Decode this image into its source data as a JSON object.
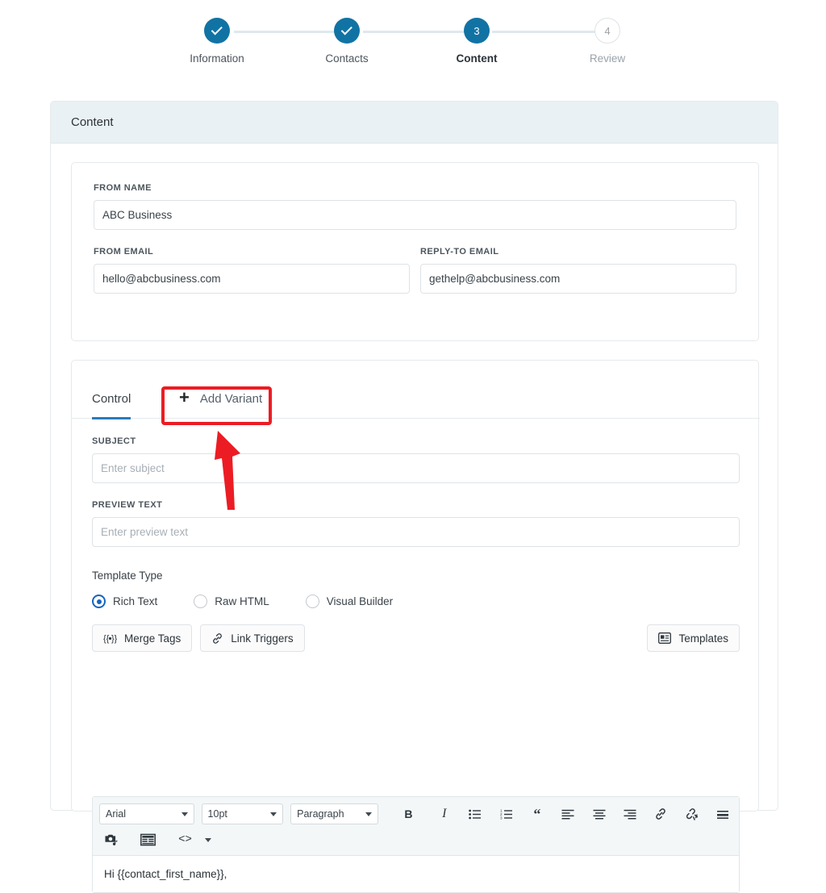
{
  "stepper": {
    "steps": [
      {
        "num": "1",
        "label": "Information",
        "state": "done",
        "icon": "check-icon"
      },
      {
        "num": "2",
        "label": "Contacts",
        "state": "done",
        "icon": "check-icon"
      },
      {
        "num": "3",
        "label": "Content",
        "state": "current",
        "icon": ""
      },
      {
        "num": "4",
        "label": "Review",
        "state": "todo",
        "icon": ""
      }
    ]
  },
  "panel": {
    "title": "Content"
  },
  "sender": {
    "from_name": {
      "label": "FROM NAME",
      "value": "ABC Business",
      "placeholder": ""
    },
    "from_email": {
      "label": "FROM EMAIL",
      "value": "hello@abcbusiness.com",
      "placeholder": ""
    },
    "reply_to_email": {
      "label": "REPLY-TO EMAIL",
      "value": "gethelp@abcbusiness.com",
      "placeholder": ""
    }
  },
  "variant": {
    "tabs": [
      {
        "id": "control",
        "label": "Control",
        "active": true
      },
      {
        "id": "add-variant",
        "label": "Add Variant",
        "icon": "plus-icon",
        "active": false
      }
    ],
    "subject": {
      "label": "SUBJECT",
      "value": "",
      "placeholder": "Enter subject"
    },
    "preview_text": {
      "label": "PREVIEW TEXT",
      "value": "",
      "placeholder": "Enter preview text"
    },
    "template_type": {
      "label": "Template Type",
      "options": [
        {
          "label": "Rich Text",
          "selected": true
        },
        {
          "label": "Raw HTML",
          "selected": false
        },
        {
          "label": "Visual Builder",
          "selected": false
        }
      ]
    },
    "actions": {
      "merge_tags": {
        "label": "Merge Tags",
        "icon": "merge-tags-icon"
      },
      "link_triggers": {
        "label": "Link Triggers",
        "icon": "link-icon"
      },
      "templates": {
        "label": "Templates",
        "icon": "template-icon"
      }
    },
    "editor": {
      "font": "Arial",
      "size": "10pt",
      "block_format": "Paragraph",
      "tools_row1": [
        "bold-icon",
        "italic-icon",
        "bullet-list-icon",
        "numbered-list-icon",
        "blockquote-icon",
        "align-left-icon",
        "align-center-icon",
        "align-right-icon",
        "insert-link-icon",
        "unlink-icon",
        "horizontal-rule-icon"
      ],
      "tools_row2": [
        "insert-image-icon",
        "insert-table-icon",
        "source-code-icon",
        "more-caret-icon"
      ],
      "body_text": "Hi {{contact_first_name}},"
    }
  },
  "colors": {
    "step_done": "#1173a4",
    "step_line": "#dfe8ee",
    "tab_active_underline": "#2b7cb8",
    "radio_selected": "#1565c0",
    "annotation": "#ec1c24",
    "panel_header_bg": "#eaf1f4"
  }
}
